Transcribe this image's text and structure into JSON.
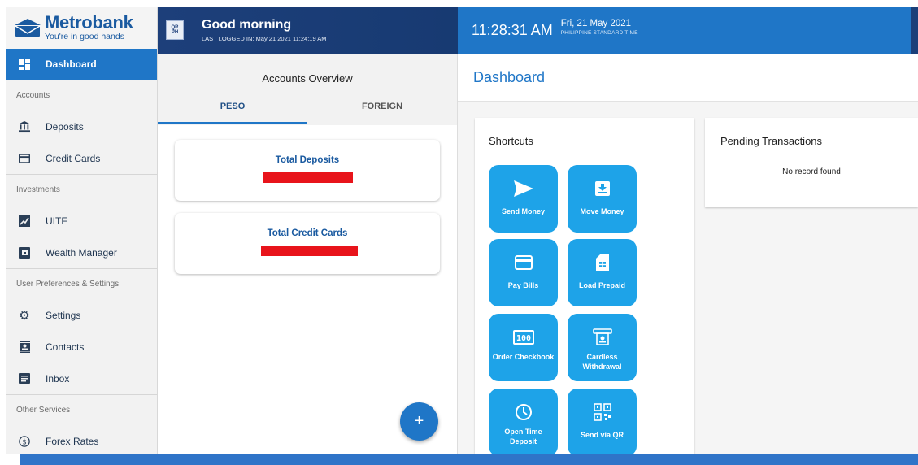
{
  "brand": {
    "name": "Metrobank",
    "tagline": "You're in good hands"
  },
  "header": {
    "greeting": "Good morning",
    "last_logged": "LAST LOGGED IN: May 21 2021 11:24:19 AM",
    "qr_badge": [
      "QR",
      "PH"
    ],
    "time": "11:28:31 AM",
    "date": "Fri, 21 May 2021",
    "timezone": "PHILIPPINE STANDARD TIME"
  },
  "sidebar": {
    "items": [
      {
        "label": "Dashboard",
        "icon": "dashboard-icon"
      },
      {
        "section": "Accounts"
      },
      {
        "label": "Deposits",
        "icon": "bank-icon"
      },
      {
        "label": "Credit Cards",
        "icon": "credit-card-icon"
      },
      {
        "section": "Investments"
      },
      {
        "label": "UITF",
        "icon": "chart-icon"
      },
      {
        "label": "Wealth Manager",
        "icon": "wealth-icon"
      },
      {
        "section": "User Preferences & Settings"
      },
      {
        "label": "Settings",
        "icon": "gear-icon"
      },
      {
        "label": "Contacts",
        "icon": "contacts-icon"
      },
      {
        "label": "Inbox",
        "icon": "inbox-icon"
      },
      {
        "section": "Other Services"
      },
      {
        "label": "Forex Rates",
        "icon": "currency-icon"
      }
    ]
  },
  "accounts": {
    "title": "Accounts Overview",
    "tabs": [
      "PESO",
      "FOREIGN"
    ],
    "cards": [
      "Total Deposits",
      "Total Credit Cards"
    ],
    "fab": "+"
  },
  "main": {
    "title": "Dashboard",
    "shortcuts_title": "Shortcuts",
    "shortcuts": [
      {
        "label": "Send Money",
        "icon": "send-icon"
      },
      {
        "label": "Move Money",
        "icon": "move-money-icon"
      },
      {
        "label": "Pay Bills",
        "icon": "bill-card-icon"
      },
      {
        "label": "Load Prepaid",
        "icon": "sim-card-icon"
      },
      {
        "label": "Order Checkbook",
        "icon": "checkbook-icon"
      },
      {
        "label": "Cardless Withdrawal",
        "icon": "atm-icon"
      },
      {
        "label": "Open Time Deposit",
        "icon": "timer-icon"
      },
      {
        "label": "Send via QR",
        "icon": "qr-icon"
      }
    ],
    "pending_title": "Pending Transactions",
    "pending_empty": "No record found"
  },
  "colors": {
    "primary": "#1f76c7",
    "header_dark": "#1d3f7a",
    "shortcut": "#1ea3e8",
    "redaction": "#e8141b"
  }
}
